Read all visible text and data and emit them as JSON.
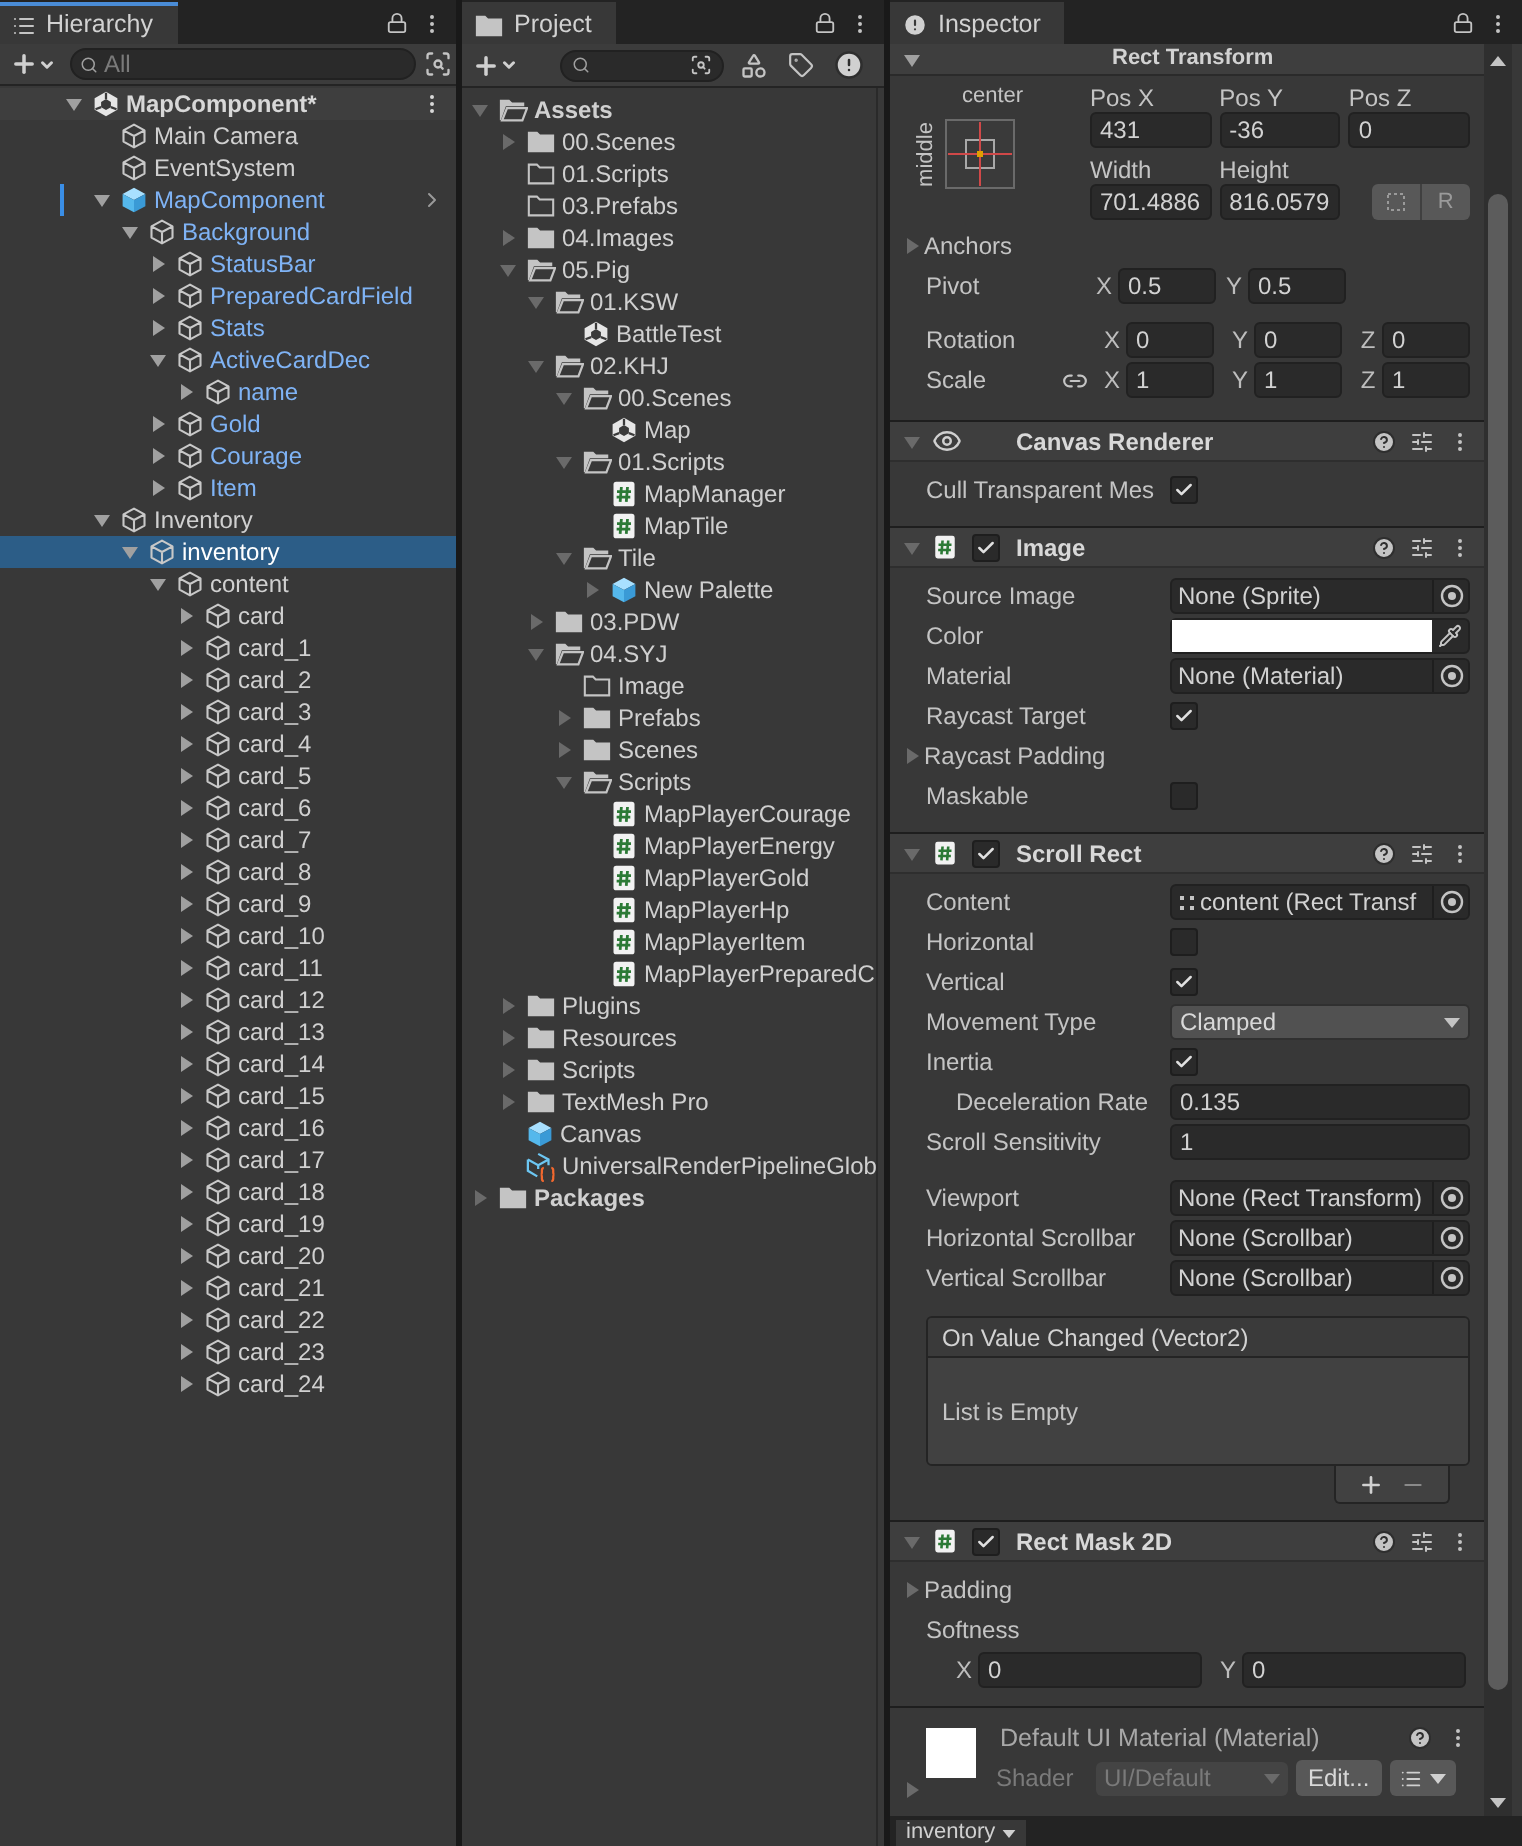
{
  "hierarchy": {
    "tab": {
      "label": "Hierarchy",
      "focused": true
    },
    "search": {
      "placeholder": "All"
    },
    "nodes": [
      {
        "label": "MapComponent*",
        "kind": "scene",
        "expanded": true,
        "selected": false,
        "children": [
          {
            "label": "Main Camera",
            "kind": "object",
            "prefab": false,
            "selected": false
          },
          {
            "label": "EventSystem",
            "kind": "object",
            "prefab": false,
            "selected": false
          },
          {
            "label": "MapComponent",
            "kind": "prefab_root",
            "prefab": true,
            "expanded": true,
            "selected": false,
            "children": [
              {
                "label": "Background",
                "kind": "object",
                "prefab": true,
                "expanded": true,
                "selected": false,
                "children": [
                  {
                    "label": "StatusBar",
                    "kind": "object",
                    "prefab": true,
                    "expanded": false,
                    "selected": false
                  },
                  {
                    "label": "PreparedCardField",
                    "kind": "object",
                    "prefab": true,
                    "expanded": false,
                    "selected": false
                  },
                  {
                    "label": "Stats",
                    "kind": "object",
                    "prefab": true,
                    "expanded": false,
                    "selected": false
                  },
                  {
                    "label": "ActiveCardDec",
                    "kind": "object",
                    "prefab": true,
                    "expanded": true,
                    "selected": false,
                    "children": [
                      {
                        "label": "name",
                        "kind": "object",
                        "prefab": true,
                        "expanded": false,
                        "selected": false
                      }
                    ]
                  },
                  {
                    "label": "Gold",
                    "kind": "object",
                    "prefab": true,
                    "expanded": false,
                    "selected": false
                  },
                  {
                    "label": "Courage",
                    "kind": "object",
                    "prefab": true,
                    "expanded": false,
                    "selected": false
                  },
                  {
                    "label": "Item",
                    "kind": "object",
                    "prefab": true,
                    "expanded": false,
                    "selected": false
                  }
                ]
              }
            ]
          },
          {
            "label": "Inventory",
            "kind": "object",
            "prefab": false,
            "expanded": true,
            "selected": false,
            "children": [
              {
                "label": "inventory",
                "kind": "object",
                "prefab": false,
                "expanded": true,
                "selected": true,
                "children": [
                  {
                    "label": "content",
                    "kind": "object",
                    "prefab": false,
                    "expanded": true,
                    "selected": false,
                    "children": [
                      {
                        "label": "card",
                        "kind": "object",
                        "prefab": false,
                        "expanded": false,
                        "selected": false
                      },
                      {
                        "label": "card_1",
                        "kind": "object",
                        "prefab": false,
                        "expanded": false,
                        "selected": false
                      },
                      {
                        "label": "card_2",
                        "kind": "object",
                        "prefab": false,
                        "expanded": false,
                        "selected": false
                      },
                      {
                        "label": "card_3",
                        "kind": "object",
                        "prefab": false,
                        "expanded": false,
                        "selected": false
                      },
                      {
                        "label": "card_4",
                        "kind": "object",
                        "prefab": false,
                        "expanded": false,
                        "selected": false
                      },
                      {
                        "label": "card_5",
                        "kind": "object",
                        "prefab": false,
                        "expanded": false,
                        "selected": false
                      },
                      {
                        "label": "card_6",
                        "kind": "object",
                        "prefab": false,
                        "expanded": false,
                        "selected": false
                      },
                      {
                        "label": "card_7",
                        "kind": "object",
                        "prefab": false,
                        "expanded": false,
                        "selected": false
                      },
                      {
                        "label": "card_8",
                        "kind": "object",
                        "prefab": false,
                        "expanded": false,
                        "selected": false
                      },
                      {
                        "label": "card_9",
                        "kind": "object",
                        "prefab": false,
                        "expanded": false,
                        "selected": false
                      },
                      {
                        "label": "card_10",
                        "kind": "object",
                        "prefab": false,
                        "expanded": false,
                        "selected": false
                      },
                      {
                        "label": "card_11",
                        "kind": "object",
                        "prefab": false,
                        "expanded": false,
                        "selected": false
                      },
                      {
                        "label": "card_12",
                        "kind": "object",
                        "prefab": false,
                        "expanded": false,
                        "selected": false
                      },
                      {
                        "label": "card_13",
                        "kind": "object",
                        "prefab": false,
                        "expanded": false,
                        "selected": false
                      },
                      {
                        "label": "card_14",
                        "kind": "object",
                        "prefab": false,
                        "expanded": false,
                        "selected": false
                      },
                      {
                        "label": "card_15",
                        "kind": "object",
                        "prefab": false,
                        "expanded": false,
                        "selected": false
                      },
                      {
                        "label": "card_16",
                        "kind": "object",
                        "prefab": false,
                        "expanded": false,
                        "selected": false
                      },
                      {
                        "label": "card_17",
                        "kind": "object",
                        "prefab": false,
                        "expanded": false,
                        "selected": false
                      },
                      {
                        "label": "card_18",
                        "kind": "object",
                        "prefab": false,
                        "expanded": false,
                        "selected": false
                      },
                      {
                        "label": "card_19",
                        "kind": "object",
                        "prefab": false,
                        "expanded": false,
                        "selected": false
                      },
                      {
                        "label": "card_20",
                        "kind": "object",
                        "prefab": false,
                        "expanded": false,
                        "selected": false
                      },
                      {
                        "label": "card_21",
                        "kind": "object",
                        "prefab": false,
                        "expanded": false,
                        "selected": false
                      },
                      {
                        "label": "card_22",
                        "kind": "object",
                        "prefab": false,
                        "expanded": false,
                        "selected": false
                      },
                      {
                        "label": "card_23",
                        "kind": "object",
                        "prefab": false,
                        "expanded": false,
                        "selected": false
                      },
                      {
                        "label": "card_24",
                        "kind": "object",
                        "prefab": false,
                        "expanded": false,
                        "selected": false
                      }
                    ]
                  }
                ]
              }
            ]
          }
        ]
      }
    ]
  },
  "project": {
    "tab": {
      "label": "Project",
      "focused": false
    },
    "nodes": [
      {
        "label": "Assets",
        "kind": "folder",
        "expanded": true,
        "children": [
          {
            "label": "00.Scenes",
            "kind": "folder",
            "expanded": false
          },
          {
            "label": "01.Scripts",
            "kind": "folder"
          },
          {
            "label": "03.Prefabs",
            "kind": "folder"
          },
          {
            "label": "04.Images",
            "kind": "folder",
            "expanded": false
          },
          {
            "label": "05.Pig",
            "kind": "folder",
            "expanded": true,
            "children": [
              {
                "label": "01.KSW",
                "kind": "folder",
                "expanded": true,
                "children": [
                  {
                    "label": "BattleTest",
                    "kind": "scene"
                  }
                ]
              },
              {
                "label": "02.KHJ",
                "kind": "folder",
                "expanded": true,
                "children": [
                  {
                    "label": "00.Scenes",
                    "kind": "folder",
                    "expanded": true,
                    "children": [
                      {
                        "label": "Map",
                        "kind": "scene"
                      }
                    ]
                  },
                  {
                    "label": "01.Scripts",
                    "kind": "folder",
                    "expanded": true,
                    "children": [
                      {
                        "label": "MapManager",
                        "kind": "script"
                      },
                      {
                        "label": "MapTile",
                        "kind": "script"
                      }
                    ]
                  },
                  {
                    "label": "Tile",
                    "kind": "folder",
                    "expanded": true,
                    "children": [
                      {
                        "label": "New Palette",
                        "kind": "prefab",
                        "expanded": false
                      }
                    ]
                  }
                ]
              },
              {
                "label": "03.PDW",
                "kind": "folder",
                "expanded": false
              },
              {
                "label": "04.SYJ",
                "kind": "folder",
                "expanded": true,
                "children": [
                  {
                    "label": "Image",
                    "kind": "folder"
                  },
                  {
                    "label": "Prefabs",
                    "kind": "folder",
                    "expanded": false
                  },
                  {
                    "label": "Scenes",
                    "kind": "folder",
                    "expanded": false
                  },
                  {
                    "label": "Scripts",
                    "kind": "folder",
                    "expanded": true,
                    "children": [
                      {
                        "label": "MapPlayerCourage",
                        "kind": "script"
                      },
                      {
                        "label": "MapPlayerEnergy",
                        "kind": "script"
                      },
                      {
                        "label": "MapPlayerGold",
                        "kind": "script"
                      },
                      {
                        "label": "MapPlayerHp",
                        "kind": "script"
                      },
                      {
                        "label": "MapPlayerItem",
                        "kind": "script"
                      },
                      {
                        "label": "MapPlayerPreparedC",
                        "kind": "script"
                      }
                    ]
                  }
                ]
              }
            ]
          },
          {
            "label": "Plugins",
            "kind": "folder",
            "expanded": false
          },
          {
            "label": "Resources",
            "kind": "folder",
            "expanded": false
          },
          {
            "label": "Scripts",
            "kind": "folder",
            "expanded": false
          },
          {
            "label": "TextMesh Pro",
            "kind": "folder",
            "expanded": false
          },
          {
            "label": "Canvas",
            "kind": "prefab"
          },
          {
            "label": "UniversalRenderPipelineGlob",
            "kind": "pipeline"
          }
        ]
      },
      {
        "label": "Packages",
        "kind": "folder",
        "expanded": false
      }
    ]
  },
  "inspector": {
    "tab": {
      "label": "Inspector",
      "focused": false
    },
    "rect_transform": {
      "title": "Rect Transform",
      "anchor_h": "center",
      "anchor_v": "middle",
      "fields": [
        {
          "label": "Pos X",
          "value": "431"
        },
        {
          "label": "Pos Y",
          "value": "-36"
        },
        {
          "label": "Pos Z",
          "value": "0"
        },
        {
          "label": "Width",
          "value": "701.4886"
        },
        {
          "label": "Height",
          "value": "816.0579"
        }
      ],
      "raw_button": "R",
      "anchors": {
        "label": "Anchors",
        "expanded": false
      },
      "pivot": {
        "label": "Pivot",
        "axes": [
          {
            "axis": "X",
            "value": "0.5"
          },
          {
            "axis": "Y",
            "value": "0.5"
          }
        ]
      },
      "rotation": {
        "label": "Rotation",
        "axes": [
          {
            "axis": "X",
            "value": "0"
          },
          {
            "axis": "Y",
            "value": "0"
          },
          {
            "axis": "Z",
            "value": "0"
          }
        ]
      },
      "scale": {
        "label": "Scale",
        "axes": [
          {
            "axis": "X",
            "value": "1"
          },
          {
            "axis": "Y",
            "value": "1"
          },
          {
            "axis": "Z",
            "value": "1"
          }
        ]
      }
    },
    "components": [
      {
        "title": "Canvas Renderer",
        "kind": "renderer",
        "rows": [
          {
            "kind": "check",
            "label": "Cull Transparent Mes",
            "checked": true
          }
        ]
      },
      {
        "title": "Image",
        "kind": "script",
        "enabled": true,
        "rows": [
          {
            "kind": "object",
            "label": "Source Image",
            "value": "None (Sprite)"
          },
          {
            "kind": "color",
            "label": "Color",
            "color": "#ffffff"
          },
          {
            "kind": "object",
            "label": "Material",
            "value": "None (Material)"
          },
          {
            "kind": "check",
            "label": "Raycast Target",
            "checked": true
          },
          {
            "kind": "foldout",
            "label": "Raycast Padding",
            "expanded": false
          },
          {
            "kind": "check",
            "label": "Maskable",
            "checked": false
          }
        ]
      },
      {
        "title": "Scroll Rect",
        "kind": "script",
        "enabled": true,
        "rows": [
          {
            "kind": "reference",
            "label": "Content",
            "value": "content (Rect Transf"
          },
          {
            "kind": "check",
            "label": "Horizontal",
            "checked": false
          },
          {
            "kind": "check",
            "label": "Vertical",
            "checked": true
          },
          {
            "kind": "dropdown",
            "label": "Movement Type",
            "value": "Clamped"
          },
          {
            "kind": "check",
            "label": "Inertia",
            "checked": true
          },
          {
            "kind": "text",
            "label": "Deceleration Rate",
            "value": "0.135",
            "indent": true
          },
          {
            "kind": "text",
            "label": "Scroll Sensitivity",
            "value": "1"
          },
          {
            "kind": "object",
            "label": "Viewport",
            "value": "None (Rect Transform)"
          },
          {
            "kind": "object",
            "label": "Horizontal Scrollbar",
            "value": "None (Scrollbar)"
          },
          {
            "kind": "object",
            "label": "Vertical Scrollbar",
            "value": "None (Scrollbar)"
          },
          {
            "kind": "event",
            "label": "On Value Changed (Vector2)",
            "value": "List is Empty"
          }
        ]
      },
      {
        "title": "Rect Mask 2D",
        "kind": "script",
        "enabled": true,
        "rows": [
          {
            "kind": "foldout",
            "label": "Padding",
            "expanded": false
          },
          {
            "kind": "label",
            "label": "Softness"
          },
          {
            "kind": "vector2",
            "axes": [
              {
                "axis": "X",
                "value": "0"
              },
              {
                "axis": "Y",
                "value": "0"
              }
            ]
          }
        ]
      }
    ],
    "material": {
      "title": "Default UI Material (Material)",
      "shader_label": "Shader",
      "shader": "UI/Default",
      "disabled": true,
      "edit_button": "Edit..."
    }
  },
  "bottom_bar": {
    "label": "inventory"
  }
}
